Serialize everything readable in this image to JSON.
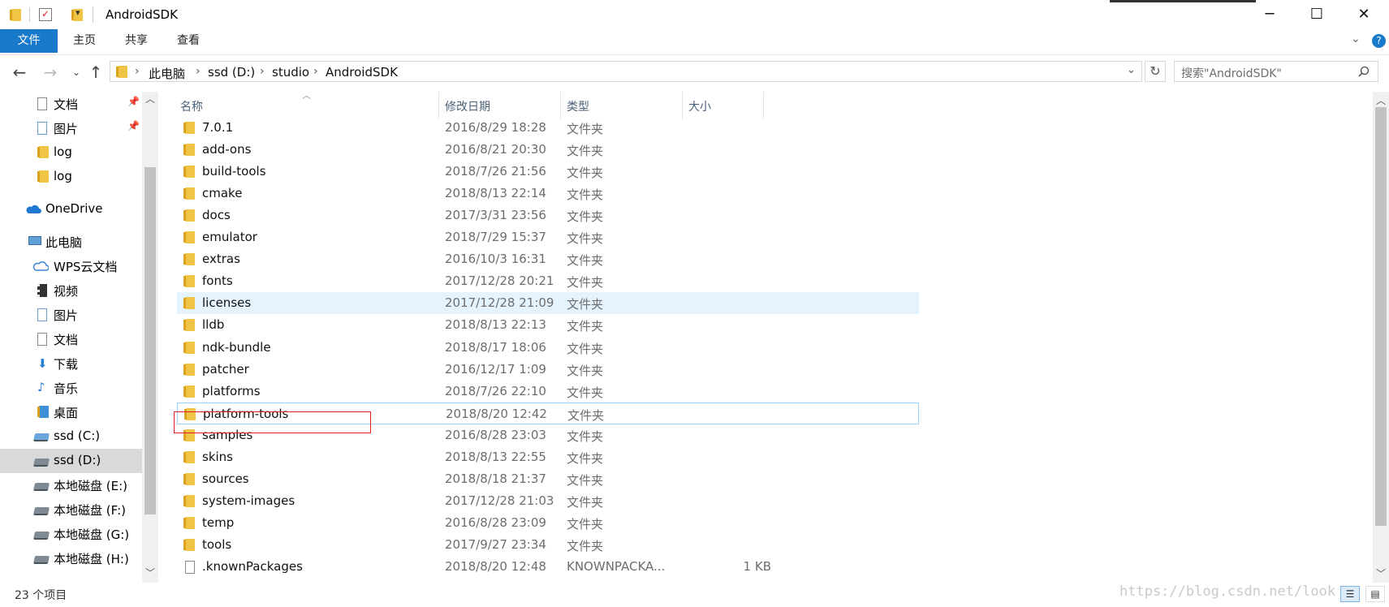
{
  "window": {
    "title": "AndroidSDK",
    "minimize": "─",
    "maximize": "☐",
    "close": "✕"
  },
  "ribbon": {
    "tabs": [
      "文件",
      "主页",
      "共享",
      "查看"
    ],
    "help": "?"
  },
  "address": {
    "crumbs": [
      "此电脑",
      "ssd (D:)",
      "studio",
      "AndroidSDK"
    ],
    "search_placeholder": "搜索\"AndroidSDK\""
  },
  "columns": {
    "name": "名称",
    "date": "修改日期",
    "type": "类型",
    "size": "大小"
  },
  "nav": {
    "items": [
      {
        "label": "文档",
        "icon": "document-icon",
        "pinned": true
      },
      {
        "label": "图片",
        "icon": "pictures-icon",
        "pinned": true
      },
      {
        "label": "log",
        "icon": "folder-icon"
      },
      {
        "label": "log",
        "icon": "folder-icon"
      },
      {
        "label": "OneDrive",
        "icon": "onedrive-icon"
      },
      {
        "label": "此电脑",
        "icon": "computer-icon"
      },
      {
        "label": "WPS云文档",
        "icon": "cloud-icon"
      },
      {
        "label": "视频",
        "icon": "video-icon"
      },
      {
        "label": "图片",
        "icon": "pictures-icon"
      },
      {
        "label": "文档",
        "icon": "document-icon"
      },
      {
        "label": "下载",
        "icon": "download-icon"
      },
      {
        "label": "音乐",
        "icon": "music-icon"
      },
      {
        "label": "桌面",
        "icon": "desktop-icon"
      },
      {
        "label": "ssd (C:)",
        "icon": "windows-drive-icon"
      },
      {
        "label": "ssd (D:)",
        "icon": "drive-icon",
        "selected": true
      },
      {
        "label": "本地磁盘 (E:)",
        "icon": "drive-icon"
      },
      {
        "label": "本地磁盘 (F:)",
        "icon": "drive-icon"
      },
      {
        "label": "本地磁盘 (G:)",
        "icon": "drive-icon"
      },
      {
        "label": "本地磁盘 (H:)",
        "icon": "drive-icon"
      }
    ]
  },
  "files": [
    {
      "name": "7.0.1",
      "date": "2016/8/29 18:28",
      "type": "文件夹",
      "size": ""
    },
    {
      "name": "add-ons",
      "date": "2016/8/21 20:30",
      "type": "文件夹",
      "size": ""
    },
    {
      "name": "build-tools",
      "date": "2018/7/26 21:56",
      "type": "文件夹",
      "size": ""
    },
    {
      "name": "cmake",
      "date": "2018/8/13 22:14",
      "type": "文件夹",
      "size": ""
    },
    {
      "name": "docs",
      "date": "2017/3/31 23:56",
      "type": "文件夹",
      "size": ""
    },
    {
      "name": "emulator",
      "date": "2018/7/29 15:37",
      "type": "文件夹",
      "size": ""
    },
    {
      "name": "extras",
      "date": "2016/10/3 16:31",
      "type": "文件夹",
      "size": ""
    },
    {
      "name": "fonts",
      "date": "2017/12/28 20:21",
      "type": "文件夹",
      "size": ""
    },
    {
      "name": "licenses",
      "date": "2017/12/28 21:09",
      "type": "文件夹",
      "size": "",
      "state": "hover"
    },
    {
      "name": "lldb",
      "date": "2018/8/13 22:13",
      "type": "文件夹",
      "size": ""
    },
    {
      "name": "ndk-bundle",
      "date": "2018/8/17 18:06",
      "type": "文件夹",
      "size": ""
    },
    {
      "name": "patcher",
      "date": "2016/12/17 1:09",
      "type": "文件夹",
      "size": ""
    },
    {
      "name": "platforms",
      "date": "2018/7/26 22:10",
      "type": "文件夹",
      "size": ""
    },
    {
      "name": "platform-tools",
      "date": "2018/8/20 12:42",
      "type": "文件夹",
      "size": "",
      "state": "focused"
    },
    {
      "name": "samples",
      "date": "2016/8/28 23:03",
      "type": "文件夹",
      "size": ""
    },
    {
      "name": "skins",
      "date": "2018/8/13 22:55",
      "type": "文件夹",
      "size": ""
    },
    {
      "name": "sources",
      "date": "2018/8/18 21:37",
      "type": "文件夹",
      "size": ""
    },
    {
      "name": "system-images",
      "date": "2017/12/28 21:03",
      "type": "文件夹",
      "size": ""
    },
    {
      "name": "temp",
      "date": "2016/8/28 23:09",
      "type": "文件夹",
      "size": ""
    },
    {
      "name": "tools",
      "date": "2017/9/27 23:34",
      "type": "文件夹",
      "size": ""
    },
    {
      "name": ".knownPackages",
      "date": "2018/8/20 12:48",
      "type": "KNOWNPACKA...",
      "size": "1 KB",
      "is_file": true
    }
  ],
  "status": {
    "count": "23 个项目",
    "watermark": "https://blog.csdn.net/look"
  },
  "colors": {
    "accent": "#1979ca",
    "hover": "#e5f3ff",
    "highlight_box": "#e02020"
  }
}
